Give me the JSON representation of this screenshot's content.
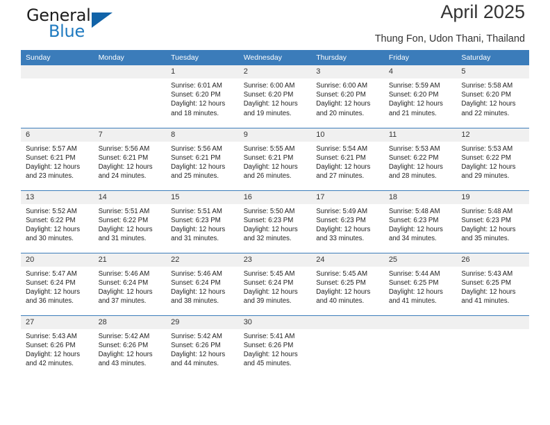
{
  "brand": {
    "name_top": "General",
    "name_bottom": "Blue"
  },
  "header": {
    "title": "April 2025",
    "subtitle": "Thung Fon, Udon Thani, Thailand"
  },
  "colors": {
    "header_blue": "#3b7cba",
    "logo_blue": "#1163a8",
    "daynum_band": "#f0f0f0"
  },
  "weekday_headers": [
    "Sunday",
    "Monday",
    "Tuesday",
    "Wednesday",
    "Thursday",
    "Friday",
    "Saturday"
  ],
  "weeks": [
    [
      {
        "day": "",
        "lines": []
      },
      {
        "day": "",
        "lines": []
      },
      {
        "day": "1",
        "lines": [
          "Sunrise: 6:01 AM",
          "Sunset: 6:20 PM",
          "Daylight: 12 hours",
          "and 18 minutes."
        ]
      },
      {
        "day": "2",
        "lines": [
          "Sunrise: 6:00 AM",
          "Sunset: 6:20 PM",
          "Daylight: 12 hours",
          "and 19 minutes."
        ]
      },
      {
        "day": "3",
        "lines": [
          "Sunrise: 6:00 AM",
          "Sunset: 6:20 PM",
          "Daylight: 12 hours",
          "and 20 minutes."
        ]
      },
      {
        "day": "4",
        "lines": [
          "Sunrise: 5:59 AM",
          "Sunset: 6:20 PM",
          "Daylight: 12 hours",
          "and 21 minutes."
        ]
      },
      {
        "day": "5",
        "lines": [
          "Sunrise: 5:58 AM",
          "Sunset: 6:20 PM",
          "Daylight: 12 hours",
          "and 22 minutes."
        ]
      }
    ],
    [
      {
        "day": "6",
        "lines": [
          "Sunrise: 5:57 AM",
          "Sunset: 6:21 PM",
          "Daylight: 12 hours",
          "and 23 minutes."
        ]
      },
      {
        "day": "7",
        "lines": [
          "Sunrise: 5:56 AM",
          "Sunset: 6:21 PM",
          "Daylight: 12 hours",
          "and 24 minutes."
        ]
      },
      {
        "day": "8",
        "lines": [
          "Sunrise: 5:56 AM",
          "Sunset: 6:21 PM",
          "Daylight: 12 hours",
          "and 25 minutes."
        ]
      },
      {
        "day": "9",
        "lines": [
          "Sunrise: 5:55 AM",
          "Sunset: 6:21 PM",
          "Daylight: 12 hours",
          "and 26 minutes."
        ]
      },
      {
        "day": "10",
        "lines": [
          "Sunrise: 5:54 AM",
          "Sunset: 6:21 PM",
          "Daylight: 12 hours",
          "and 27 minutes."
        ]
      },
      {
        "day": "11",
        "lines": [
          "Sunrise: 5:53 AM",
          "Sunset: 6:22 PM",
          "Daylight: 12 hours",
          "and 28 minutes."
        ]
      },
      {
        "day": "12",
        "lines": [
          "Sunrise: 5:53 AM",
          "Sunset: 6:22 PM",
          "Daylight: 12 hours",
          "and 29 minutes."
        ]
      }
    ],
    [
      {
        "day": "13",
        "lines": [
          "Sunrise: 5:52 AM",
          "Sunset: 6:22 PM",
          "Daylight: 12 hours",
          "and 30 minutes."
        ]
      },
      {
        "day": "14",
        "lines": [
          "Sunrise: 5:51 AM",
          "Sunset: 6:22 PM",
          "Daylight: 12 hours",
          "and 31 minutes."
        ]
      },
      {
        "day": "15",
        "lines": [
          "Sunrise: 5:51 AM",
          "Sunset: 6:23 PM",
          "Daylight: 12 hours",
          "and 31 minutes."
        ]
      },
      {
        "day": "16",
        "lines": [
          "Sunrise: 5:50 AM",
          "Sunset: 6:23 PM",
          "Daylight: 12 hours",
          "and 32 minutes."
        ]
      },
      {
        "day": "17",
        "lines": [
          "Sunrise: 5:49 AM",
          "Sunset: 6:23 PM",
          "Daylight: 12 hours",
          "and 33 minutes."
        ]
      },
      {
        "day": "18",
        "lines": [
          "Sunrise: 5:48 AM",
          "Sunset: 6:23 PM",
          "Daylight: 12 hours",
          "and 34 minutes."
        ]
      },
      {
        "day": "19",
        "lines": [
          "Sunrise: 5:48 AM",
          "Sunset: 6:23 PM",
          "Daylight: 12 hours",
          "and 35 minutes."
        ]
      }
    ],
    [
      {
        "day": "20",
        "lines": [
          "Sunrise: 5:47 AM",
          "Sunset: 6:24 PM",
          "Daylight: 12 hours",
          "and 36 minutes."
        ]
      },
      {
        "day": "21",
        "lines": [
          "Sunrise: 5:46 AM",
          "Sunset: 6:24 PM",
          "Daylight: 12 hours",
          "and 37 minutes."
        ]
      },
      {
        "day": "22",
        "lines": [
          "Sunrise: 5:46 AM",
          "Sunset: 6:24 PM",
          "Daylight: 12 hours",
          "and 38 minutes."
        ]
      },
      {
        "day": "23",
        "lines": [
          "Sunrise: 5:45 AM",
          "Sunset: 6:24 PM",
          "Daylight: 12 hours",
          "and 39 minutes."
        ]
      },
      {
        "day": "24",
        "lines": [
          "Sunrise: 5:45 AM",
          "Sunset: 6:25 PM",
          "Daylight: 12 hours",
          "and 40 minutes."
        ]
      },
      {
        "day": "25",
        "lines": [
          "Sunrise: 5:44 AM",
          "Sunset: 6:25 PM",
          "Daylight: 12 hours",
          "and 41 minutes."
        ]
      },
      {
        "day": "26",
        "lines": [
          "Sunrise: 5:43 AM",
          "Sunset: 6:25 PM",
          "Daylight: 12 hours",
          "and 41 minutes."
        ]
      }
    ],
    [
      {
        "day": "27",
        "lines": [
          "Sunrise: 5:43 AM",
          "Sunset: 6:26 PM",
          "Daylight: 12 hours",
          "and 42 minutes."
        ]
      },
      {
        "day": "28",
        "lines": [
          "Sunrise: 5:42 AM",
          "Sunset: 6:26 PM",
          "Daylight: 12 hours",
          "and 43 minutes."
        ]
      },
      {
        "day": "29",
        "lines": [
          "Sunrise: 5:42 AM",
          "Sunset: 6:26 PM",
          "Daylight: 12 hours",
          "and 44 minutes."
        ]
      },
      {
        "day": "30",
        "lines": [
          "Sunrise: 5:41 AM",
          "Sunset: 6:26 PM",
          "Daylight: 12 hours",
          "and 45 minutes."
        ]
      },
      {
        "day": "",
        "lines": []
      },
      {
        "day": "",
        "lines": []
      },
      {
        "day": "",
        "lines": []
      }
    ]
  ]
}
